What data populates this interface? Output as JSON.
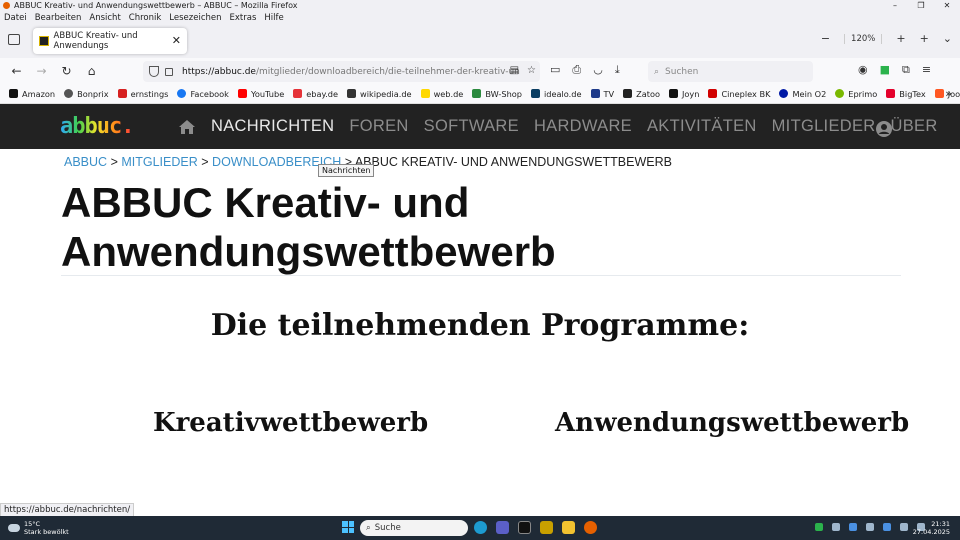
{
  "window": {
    "title": "ABBUC Kreativ- und Anwendungswettbewerb – ABBUC – Mozilla Firefox",
    "controls": [
      "–",
      "❐",
      "✕"
    ]
  },
  "menubar": {
    "items": [
      "Datei",
      "Bearbeiten",
      "Ansicht",
      "Chronik",
      "Lesezeichen",
      "Extras",
      "Hilfe"
    ]
  },
  "tab": {
    "title": "ABBUC Kreativ- und Anwendungs",
    "close": "✕",
    "zoom": "120%"
  },
  "urlbar": {
    "host": "https://abbuc.de",
    "path": "/mitglieder/downloadbereich/die-teilnehmer-der-kreativ-un"
  },
  "search": {
    "placeholder": "Suchen"
  },
  "bookmarks": [
    {
      "label": "Amazon",
      "color": "#111111"
    },
    {
      "label": "Bonprix",
      "color": "#555555"
    },
    {
      "label": "ernstings",
      "color": "#d62020"
    },
    {
      "label": "Facebook",
      "color": "#1877f2"
    },
    {
      "label": "YouTube",
      "color": "#ff0000"
    },
    {
      "label": "ebay.de",
      "color": "#e53238"
    },
    {
      "label": "wikipedia.de",
      "color": "#333333"
    },
    {
      "label": "web.de",
      "color": "#ffd800"
    },
    {
      "label": "BW-Shop",
      "color": "#2b8a3e"
    },
    {
      "label": "idealo.de",
      "color": "#0a3d62"
    },
    {
      "label": "TV",
      "color": "#1e3a8a"
    },
    {
      "label": "Zatoo",
      "color": "#222222"
    },
    {
      "label": "Joyn",
      "color": "#111111"
    },
    {
      "label": "Cineplex BK",
      "color": "#d10000"
    },
    {
      "label": "Mein O2",
      "color": "#0019a5"
    },
    {
      "label": "Eprimo",
      "color": "#7ab800"
    },
    {
      "label": "BigTex",
      "color": "#e4002b"
    },
    {
      "label": "Joom",
      "color": "#ff5722"
    }
  ],
  "site": {
    "logo": "abbuc.",
    "nav": [
      "NACHRICHTEN",
      "FOREN",
      "SOFTWARE",
      "HARDWARE",
      "AKTIVITÄTEN",
      "MITGLIEDER",
      "ÜBER"
    ],
    "tooltip": "Nachrichten"
  },
  "breadcrumb": {
    "items": [
      "ABBUC",
      "MITGLIEDER",
      "DOWNLOADBEREICH"
    ],
    "separator": ">",
    "current": "ABBUC KREATIV- UND ANWENDUNGSWETTBEWERB"
  },
  "page": {
    "title": "ABBUC Kreativ- und Anwendungswettbewerb",
    "subtitle": "Die teilnehmenden Programme:",
    "col_left": "Kreativwettbewerb",
    "col_right": "Anwendungswettbewerb"
  },
  "status_url": "https://abbuc.de/nachrichten/",
  "taskbar": {
    "temp": "15°C",
    "weather": "Stark bewölkt",
    "search": "Suche",
    "time": "21:31",
    "date": "27.04.2025"
  }
}
